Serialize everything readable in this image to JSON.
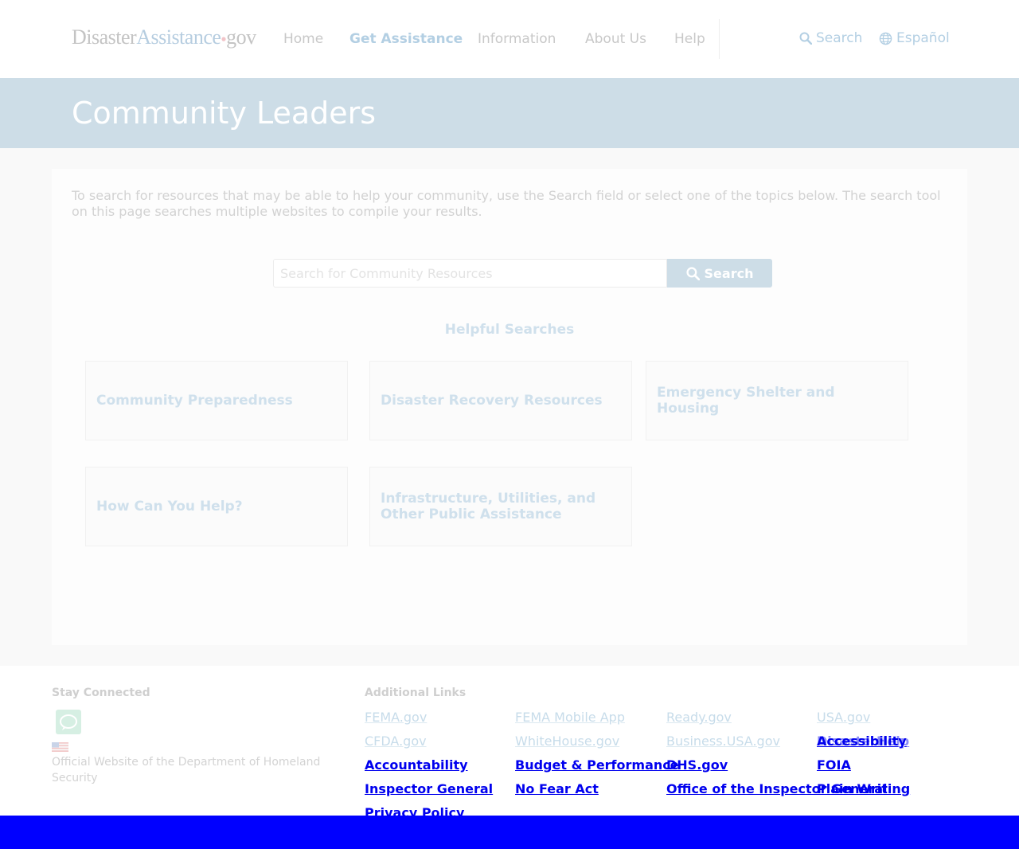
{
  "logo": {
    "part1": "Disaster",
    "part2": "Assistance",
    "dot": "●",
    "part3": "gov"
  },
  "nav": {
    "items": [
      {
        "label": "Home",
        "active": false
      },
      {
        "label": "Get Assistance",
        "active": true
      },
      {
        "label": "Information",
        "active": false
      },
      {
        "label": "About Us",
        "active": false
      },
      {
        "label": "Help",
        "active": false
      }
    ]
  },
  "utility": {
    "search_label": "Search",
    "search_icon": "search-icon",
    "language_label": "Español",
    "language_icon": "globe-icon"
  },
  "banner": {
    "title": "Community Leaders"
  },
  "main": {
    "intro": "To search for resources that may be able to help your community, use the Search field or select one of the topics below. The search tool on this page searches multiple websites to compile your results.",
    "search": {
      "placeholder": "Search for Community Resources",
      "value": "",
      "button_label": "Search"
    },
    "helpful_heading": "Helpful Searches",
    "cards": [
      "Community Preparedness",
      "Disaster Recovery Resources",
      "Emergency Shelter and Housing",
      "How Can You Help?",
      "Infrastructure, Utilities, and Other Public Assistance"
    ]
  },
  "footer": {
    "stay_connected": "Stay Connected",
    "chat_icon": "chat-icon",
    "official": "Official Website of the Department of Homeland Security",
    "additional_links": "Additional Links",
    "links": [
      "FEMA.gov",
      "FEMA Mobile App",
      "Ready.gov",
      "USA.gov",
      "CFDA.gov",
      "WhiteHouse.gov",
      "Business.USA.gov",
      "DisasterHelp",
      "Accessibility",
      "Accountability",
      "Budget & Performance",
      "DHS.gov",
      "FOIA",
      "Inspector General",
      "No Fear Act",
      "Office of the Inspector General",
      "Plain Writing",
      "Privacy Policy"
    ]
  },
  "colors": {
    "banner": "#cddde7",
    "accent_light": "#b3cfe3",
    "bottom_bar": "#0000ff",
    "link_bright": "#0000ee"
  }
}
